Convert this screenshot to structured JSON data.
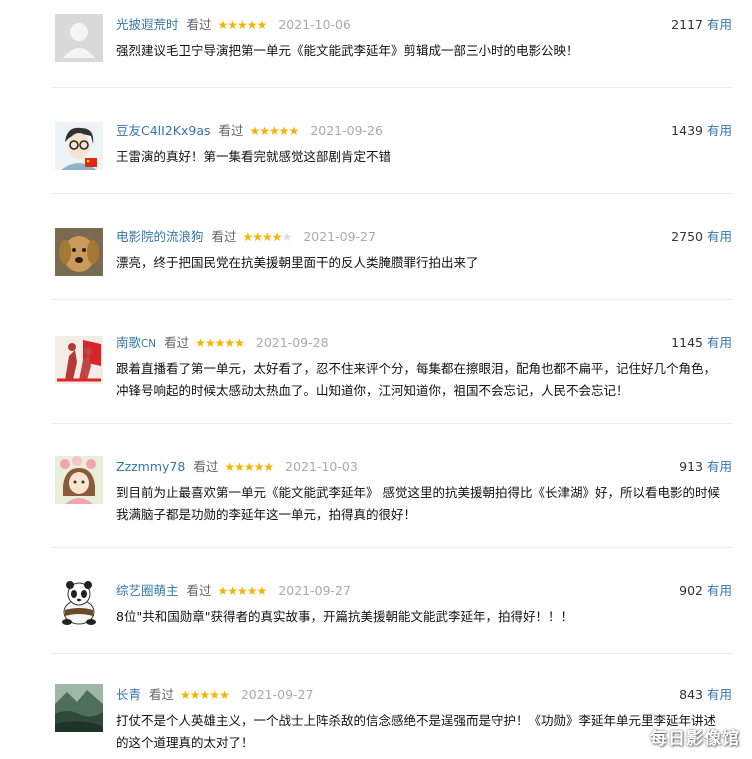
{
  "comments": [
    {
      "user": "光披遐荒时",
      "user_suffix": "",
      "status": "看过",
      "rating": 5,
      "date": "2021-10-06",
      "votes": "2117",
      "useful_label": "有用",
      "text": "强烈建议毛卫宁导演把第一单元《能文能武李延年》剪辑成一部三小时的电影公映！",
      "avatar": "default-user-icon"
    },
    {
      "user": "豆友C4lI2Kx9as",
      "user_suffix": "",
      "status": "看过",
      "rating": 5,
      "date": "2021-09-26",
      "votes": "1439",
      "useful_label": "有用",
      "text": "王雷演的真好！第一集看完就感觉这部剧肯定不错",
      "avatar": "cartoon-glasses-avatar"
    },
    {
      "user": "电影院的流浪狗",
      "user_suffix": "",
      "status": "看过",
      "rating": 4,
      "date": "2021-09-27",
      "votes": "2750",
      "useful_label": "有用",
      "text": "漂亮，终于把国民党在抗美援朝里面干的反人类腌臜罪行拍出来了",
      "avatar": "golden-retriever-avatar"
    },
    {
      "user": "南歌",
      "user_suffix": "CN",
      "status": "看过",
      "rating": 5,
      "date": "2021-09-28",
      "votes": "1145",
      "useful_label": "有用",
      "text": "跟着直播看了第一单元，太好看了，忍不住来评个分，每集都在擦眼泪，配角也都不扁平，记住好几个角色，冲锋号响起的时候太感动太热血了。山知道你，江河知道你，祖国不会忘记，人民不会忘记！",
      "avatar": "soldiers-flag-avatar"
    },
    {
      "user": "Zzzmmy78",
      "user_suffix": "",
      "status": "看过",
      "rating": 5,
      "date": "2021-10-03",
      "votes": "913",
      "useful_label": "有用",
      "text": "到目前为止最喜欢第一单元《能文能武李延年》 感觉这里的抗美援朝拍得比《长津湖》好，所以看电影的时候我满脑子都是功勋的李延年这一单元，拍得真的很好！",
      "avatar": "flower-girl-avatar"
    },
    {
      "user": "综艺圈萌主",
      "user_suffix": "",
      "status": "看过",
      "rating": 5,
      "date": "2021-09-27",
      "votes": "902",
      "useful_label": "有用",
      "text": "8位\"共和国勋章\"获得者的真实故事，开篇抗美援朝能文能武李延年，拍得好！！！",
      "avatar": "kungfu-panda-avatar"
    },
    {
      "user": "长青",
      "user_suffix": "",
      "status": "看过",
      "rating": 5,
      "date": "2021-09-27",
      "votes": "843",
      "useful_label": "有用",
      "text": "打仗不是个人英雄主义，一个战士上阵杀敌的信念感绝不是逞强而是守护！《功勋》李延年单元里李延年讲述的这个道理真的太对了！",
      "avatar": "landscape-avatar"
    }
  ],
  "watermark": "每日影像馆",
  "colors": {
    "link": "#3377aa",
    "star": "#f5b400",
    "star_off": "#dddddd",
    "date": "#aaaaaa",
    "divider": "#eaeaea"
  }
}
